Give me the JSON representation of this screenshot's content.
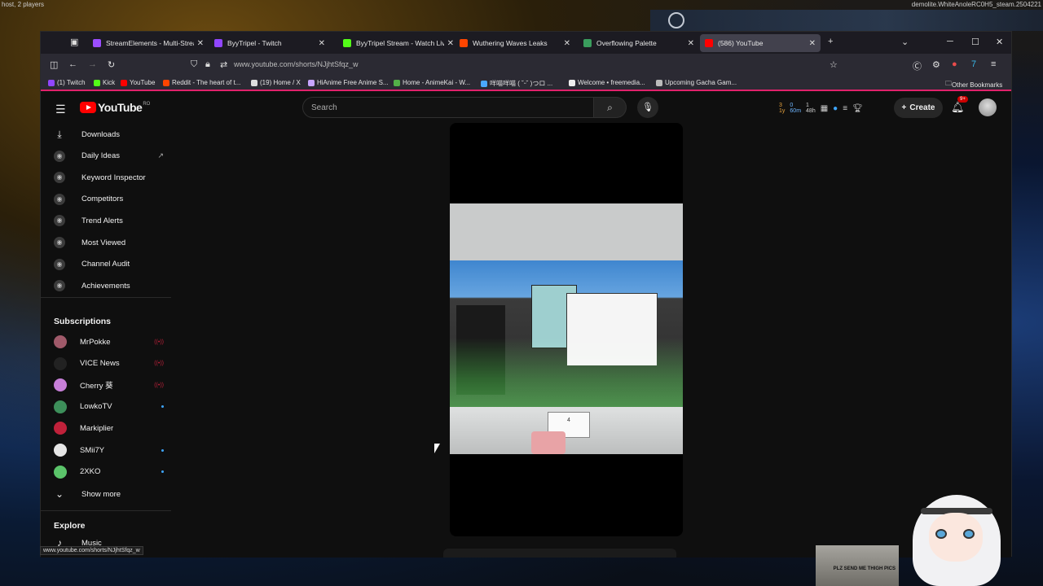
{
  "desktop": {
    "top_left": "host, 2 players",
    "top_right": "demolite.WhiteAnoleRC0H5_steam.2504221"
  },
  "tabs": [
    {
      "title": "StreamElements - Multi-Stream",
      "color": "#9b4dff"
    },
    {
      "title": "ByyTripel - Twitch",
      "color": "#9146ff"
    },
    {
      "title": "ByyTripel Stream - Watch Live o",
      "color": "#53fc18"
    },
    {
      "title": "Wuthering Waves Leaks",
      "color": "#ff4500"
    },
    {
      "title": "Overflowing Palette",
      "color": "#3a9d5d"
    },
    {
      "title": "(586) YouTube",
      "color": "#ff0000"
    }
  ],
  "address_bar": {
    "url": "www.youtube.com/shorts/NJjhtSfqz_w"
  },
  "bookmarks": [
    {
      "label": "(1) Twitch",
      "color": "#9146ff"
    },
    {
      "label": "Kick",
      "color": "#53fc18"
    },
    {
      "label": "YouTube",
      "color": "#ff0000"
    },
    {
      "label": "Reddit - The heart of t...",
      "color": "#ff4500"
    },
    {
      "label": "(19) Home / X",
      "color": "#dddddd"
    },
    {
      "label": "HiAnime Free Anime S...",
      "color": "#c7a5ff"
    },
    {
      "label": "Home - AnimeKai - W...",
      "color": "#53b048"
    },
    {
      "label": "咩喵咩喵 ( ˘ᵕ˘ )つロ ...",
      "color": "#4aa8ff"
    },
    {
      "label": "Welcome • freemedia...",
      "color": "#eeeeee"
    },
    {
      "label": "Upcoming Gacha Gam...",
      "color": "#bbbbbb"
    }
  ],
  "other_bookmarks": "Other Bookmarks",
  "youtube": {
    "logo": "YouTube",
    "country": "RO",
    "search_placeholder": "Search",
    "create_label": "Create",
    "notification_count": "9+",
    "ext_stats": {
      "a": "3",
      "b": "0",
      "c": "1",
      "a2": "1y",
      "b2": "60m",
      "c2": "48h"
    }
  },
  "sidebar": {
    "items": [
      {
        "label": "Downloads",
        "icon": "download-icon"
      },
      {
        "label": "Daily Ideas",
        "icon": "vidiq-icon"
      },
      {
        "label": "Keyword Inspector",
        "icon": "vidiq-icon"
      },
      {
        "label": "Competitors",
        "icon": "vidiq-icon"
      },
      {
        "label": "Trend Alerts",
        "icon": "vidiq-icon"
      },
      {
        "label": "Most Viewed",
        "icon": "vidiq-icon"
      },
      {
        "label": "Channel Audit",
        "icon": "vidiq-icon"
      },
      {
        "label": "Achievements",
        "icon": "vidiq-icon"
      }
    ],
    "subscriptions_title": "Subscriptions",
    "subscriptions": [
      {
        "name": "MrPokke",
        "status": "live",
        "color": "#a05a6a"
      },
      {
        "name": "VICE News",
        "status": "live",
        "color": "#222222"
      },
      {
        "name": "Cherry 葵",
        "status": "live",
        "color": "#c77fd8"
      },
      {
        "name": "LowkoTV",
        "status": "new",
        "color": "#3d8f5a"
      },
      {
        "name": "Markiplier",
        "status": "none",
        "color": "#c0213a"
      },
      {
        "name": "SMii7Y",
        "status": "new",
        "color": "#e6e6e6"
      },
      {
        "name": "2XKO",
        "status": "new",
        "color": "#5bc46a"
      }
    ],
    "show_more": "Show more",
    "explore_title": "Explore",
    "explore_first": "Music"
  },
  "video": {
    "calendar_text": "4"
  },
  "status_url": "www.youtube.com/shorts/NJjhtSfqz_w",
  "sticker_text": "PLZ SEND ME THIGH PICS"
}
